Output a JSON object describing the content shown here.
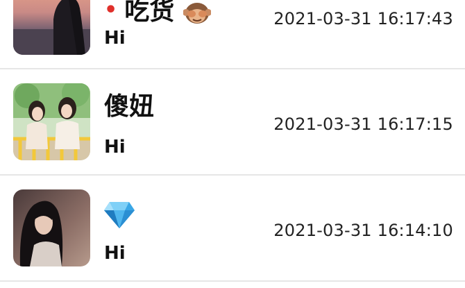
{
  "conversations": [
    {
      "name": "吃货",
      "name_emoji": "monkey-face-icon",
      "unread_dot": "•",
      "last_message": "Hi",
      "timestamp": "2021-03-31 16:17:43",
      "avatar": "sunset-silhouette-avatar"
    },
    {
      "name": "傻妞",
      "last_message": "Hi",
      "timestamp": "2021-03-31 16:17:15",
      "avatar": "two-girls-avatar"
    },
    {
      "name": "",
      "name_emoji": "gem-icon",
      "last_message": "Hi",
      "timestamp": "2021-03-31 16:14:10",
      "avatar": "dark-hair-avatar"
    }
  ],
  "colors": {
    "unread_dot": "#e0302b",
    "divider": "#e6e6e6",
    "gem": "#3aa7e6"
  }
}
